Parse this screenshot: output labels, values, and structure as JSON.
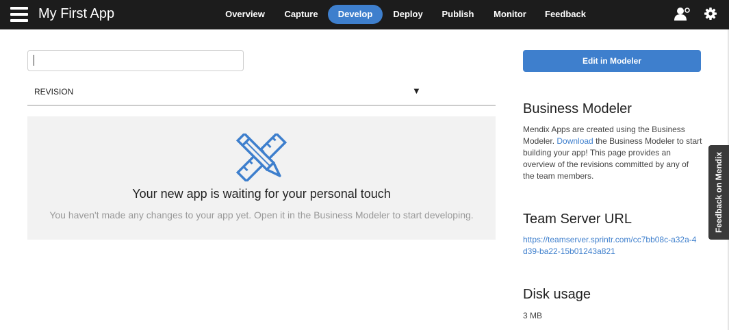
{
  "header": {
    "app_title": "My First App",
    "nav": [
      {
        "label": "Overview",
        "active": false
      },
      {
        "label": "Capture",
        "active": false
      },
      {
        "label": "Develop",
        "active": true
      },
      {
        "label": "Deploy",
        "active": false
      },
      {
        "label": "Publish",
        "active": false
      },
      {
        "label": "Monitor",
        "active": false
      },
      {
        "label": "Feedback",
        "active": false
      }
    ],
    "icons": {
      "menu": "hamburger-icon",
      "user": "user-settings-icon",
      "settings": "gear-icon"
    }
  },
  "main": {
    "search_value": "",
    "revision_label": "REVISION",
    "dropdown_arrow": "▼",
    "empty_state": {
      "icon": "ruler-pencil-icon",
      "title": "Your new app is waiting for your personal touch",
      "subtitle": "You haven't made any changes to your app yet. Open it in the Business Modeler to start developing."
    }
  },
  "sidebar": {
    "edit_button": "Edit in Modeler",
    "modeler_heading": "Business Modeler",
    "modeler_text_before": "Mendix Apps are created using the Business Modeler. ",
    "modeler_link": "Download",
    "modeler_text_after": " the Business Modeler to start building your app! This page provides an overview of the revisions committed by any of the team members.",
    "team_server_heading": "Team Server URL",
    "team_server_url": "https://teamserver.sprintr.com/cc7bb08c-a32a-4d39-ba22-15b01243a821",
    "disk_heading": "Disk usage",
    "disk_value": "3 MB"
  },
  "feedback_tab": "Feedback on Mendix",
  "colors": {
    "accent": "#3e7fcd",
    "topbar": "#1c1c1c",
    "panel": "#f2f2f2"
  }
}
